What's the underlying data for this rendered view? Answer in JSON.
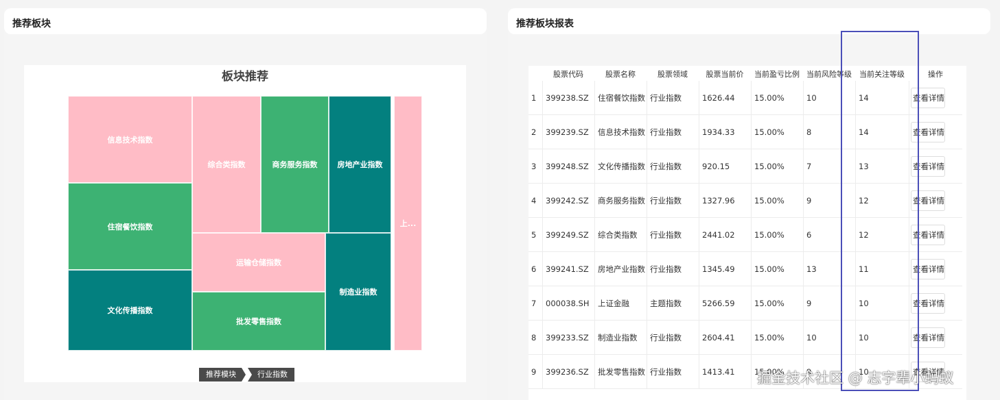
{
  "left_panel": {
    "title": "推荐板块"
  },
  "right_panel": {
    "title": "推荐板块报表"
  },
  "chart_data": {
    "type": "treemap",
    "title": "板块推荐",
    "colors": {
      "pink": "#ffbcc6",
      "green": "#3db273",
      "teal": "#03807f"
    },
    "nodes": [
      {
        "name": "信息技术指数",
        "color": "pink"
      },
      {
        "name": "住宿餐饮指数",
        "color": "green"
      },
      {
        "name": "文化传播指数",
        "color": "teal"
      },
      {
        "name": "综合类指数",
        "color": "pink"
      },
      {
        "name": "商务服务指数",
        "color": "green"
      },
      {
        "name": "房地产业指数",
        "color": "teal"
      },
      {
        "name": "运输仓储指数",
        "color": "pink"
      },
      {
        "name": "批发零售指数",
        "color": "green"
      },
      {
        "name": "制造业指数",
        "color": "teal"
      },
      {
        "name": "上...",
        "color": "pink"
      }
    ],
    "breadcrumb": [
      "推荐模块",
      "行业指数"
    ]
  },
  "table": {
    "headers": [
      "股票代码",
      "股票名称",
      "股票领域",
      "股票当前价",
      "当前盈亏比例",
      "当前风险等级",
      "当前关注等级",
      "操作"
    ],
    "action_label": "查看详情",
    "rows": [
      {
        "idx": "1",
        "code": "399238.SZ",
        "name": "住宿餐饮指数",
        "field": "行业指数",
        "price": "1626.44",
        "pnl": "15.00%",
        "risk": "10",
        "focus": "14"
      },
      {
        "idx": "2",
        "code": "399239.SZ",
        "name": "信息技术指数",
        "field": "行业指数",
        "price": "1934.33",
        "pnl": "15.00%",
        "risk": "8",
        "focus": "14"
      },
      {
        "idx": "3",
        "code": "399248.SZ",
        "name": "文化传播指数",
        "field": "行业指数",
        "price": "920.15",
        "pnl": "15.00%",
        "risk": "7",
        "focus": "13"
      },
      {
        "idx": "4",
        "code": "399242.SZ",
        "name": "商务服务指数",
        "field": "行业指数",
        "price": "1327.96",
        "pnl": "15.00%",
        "risk": "9",
        "focus": "12"
      },
      {
        "idx": "5",
        "code": "399249.SZ",
        "name": "综合类指数",
        "field": "行业指数",
        "price": "2441.02",
        "pnl": "15.00%",
        "risk": "6",
        "focus": "12"
      },
      {
        "idx": "6",
        "code": "399241.SZ",
        "name": "房地产业指数",
        "field": "行业指数",
        "price": "1345.49",
        "pnl": "15.00%",
        "risk": "13",
        "focus": "11"
      },
      {
        "idx": "7",
        "code": "000038.SH",
        "name": "上证金融",
        "field": "主题指数",
        "price": "5266.59",
        "pnl": "15.00%",
        "risk": "9",
        "focus": "10"
      },
      {
        "idx": "8",
        "code": "399233.SZ",
        "name": "制造业指数",
        "field": "行业指数",
        "price": "2604.41",
        "pnl": "15.00%",
        "risk": "10",
        "focus": "10"
      },
      {
        "idx": "9",
        "code": "399236.SZ",
        "name": "批发零售指数",
        "field": "行业指数",
        "price": "1413.41",
        "pnl": "15.00%",
        "risk": "9",
        "focus": "10"
      }
    ]
  },
  "watermark": "掘金技术社区 @ 志字辈小蚂蚁"
}
